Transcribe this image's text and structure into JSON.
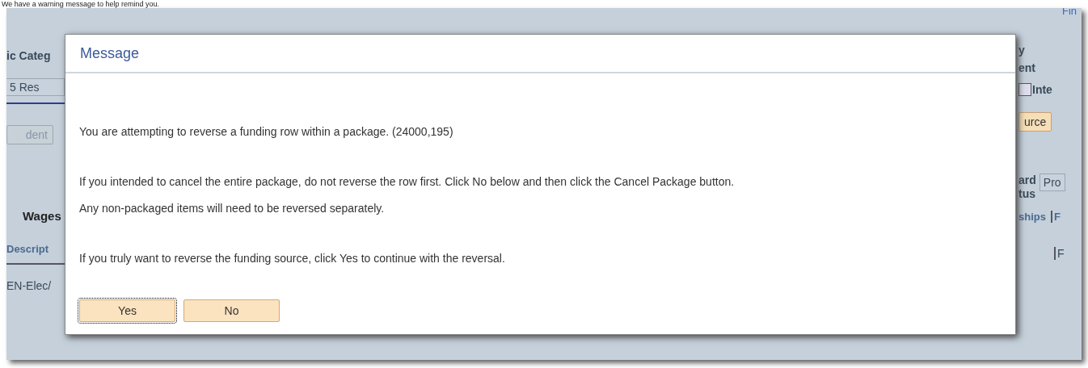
{
  "caption": "We have a warning message to help remind you.",
  "background": {
    "link": "Fin",
    "left": {
      "label": "ic Categ",
      "field_value": "5 Res",
      "button": "dent",
      "section_title": "Wages",
      "column": "Descript",
      "cell": "EN-Elec/"
    },
    "right": {
      "label_lines": [
        "y",
        "ent"
      ],
      "checkbox": {
        "label": "Inte",
        "checked": false
      },
      "button": "urce",
      "status_label_lines": [
        "ard",
        "tus"
      ],
      "status_value": "Pro",
      "column": "ships",
      "column_2": "F",
      "cell": "F"
    }
  },
  "dialog": {
    "title": "Message",
    "paragraphs": [
      [
        "You are attempting to reverse a funding row within a package. (24000,195)"
      ],
      [
        "If you intended to cancel the entire package, do not reverse the row first. Click No below and then click the Cancel Package button.",
        "Any non-packaged items will need to be reversed separately."
      ],
      [
        "If you truly want to reverse the funding source, click Yes to continue with the reversal."
      ]
    ],
    "buttons": [
      {
        "label": "Yes",
        "focused": true
      },
      {
        "label": "No",
        "focused": false
      }
    ]
  }
}
